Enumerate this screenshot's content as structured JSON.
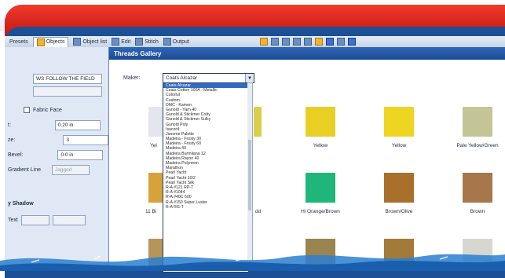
{
  "toolbar": {
    "items": [
      {
        "label": "Presets"
      },
      {
        "label": "Objects"
      },
      {
        "label": "Object list"
      },
      {
        "label": "Edit"
      },
      {
        "label": "Stitch"
      },
      {
        "label": "Output"
      }
    ],
    "right_icon": "toolbar-icons"
  },
  "left_panel": {
    "field_text": "WS FOLLOW THE FIELD",
    "checkbox_label": "Fabric Face",
    "values": [
      "0.20 in",
      "3",
      "0.0 in"
    ],
    "labels": [
      "t:",
      "ze:",
      "Bevel:",
      "Gradient Line"
    ],
    "disabled_field": "Jagged",
    "shadow_label": "y Shadow",
    "extra_label": "Text"
  },
  "gallery": {
    "title": "Threads Gallery",
    "maker_label": "Maker:",
    "maker_value": "Coats Alcazar",
    "dropdown_options": [
      "Coats Alcazar",
      "Coats Cotton 100A - Metallic",
      "Colorful",
      "Custom",
      "DMC - Kamen",
      "Gunold - Yarn 40",
      "Gunold & Stickmer Cotty",
      "Gunold & Stickmer Sulky",
      "Gunold Poly",
      "Isacord",
      "Janome Palette",
      "Madeira - Frosty 30",
      "Madeira - Frosty 60",
      "Madeira 40",
      "Madeira Burmilana 12",
      "Madeira Rayon 40",
      "Madeira Polyneon",
      "Marathon",
      "Pearl Yacht",
      "Pearl Yacht 10/2",
      "Pearl Yacht Silk",
      "R-A #121 RP-T",
      "R-A #1044",
      "R-A #40C 600",
      "R-A #150 Super Luster",
      "R-A RG-T"
    ],
    "swatches_row1": [
      {
        "label": "Yellow",
        "color": "#e8cf24"
      },
      {
        "label": "Yellow",
        "color": "#eed522"
      },
      {
        "label": "Pale Yellow/Green",
        "color": "#c4c596"
      }
    ],
    "swatches_row2": [
      {
        "label": "Hi Orange/Brown",
        "color": "#20b67a"
      },
      {
        "label": "Brown/Olive",
        "color": "#a8702a"
      },
      {
        "label": "Brown",
        "color": "#a7764a"
      }
    ],
    "swatches_row3": [
      {
        "color": "#9a8550"
      },
      {
        "color": "#a47a3a"
      },
      {
        "color": "#d7d7d2"
      }
    ],
    "left_partial_label_row1": "Yel",
    "left_partial_label_row2": "11 Bi",
    "col2_partial_label": "dd",
    "left_swatch_colors": [
      "#d6a23a",
      "#b7955a"
    ]
  }
}
